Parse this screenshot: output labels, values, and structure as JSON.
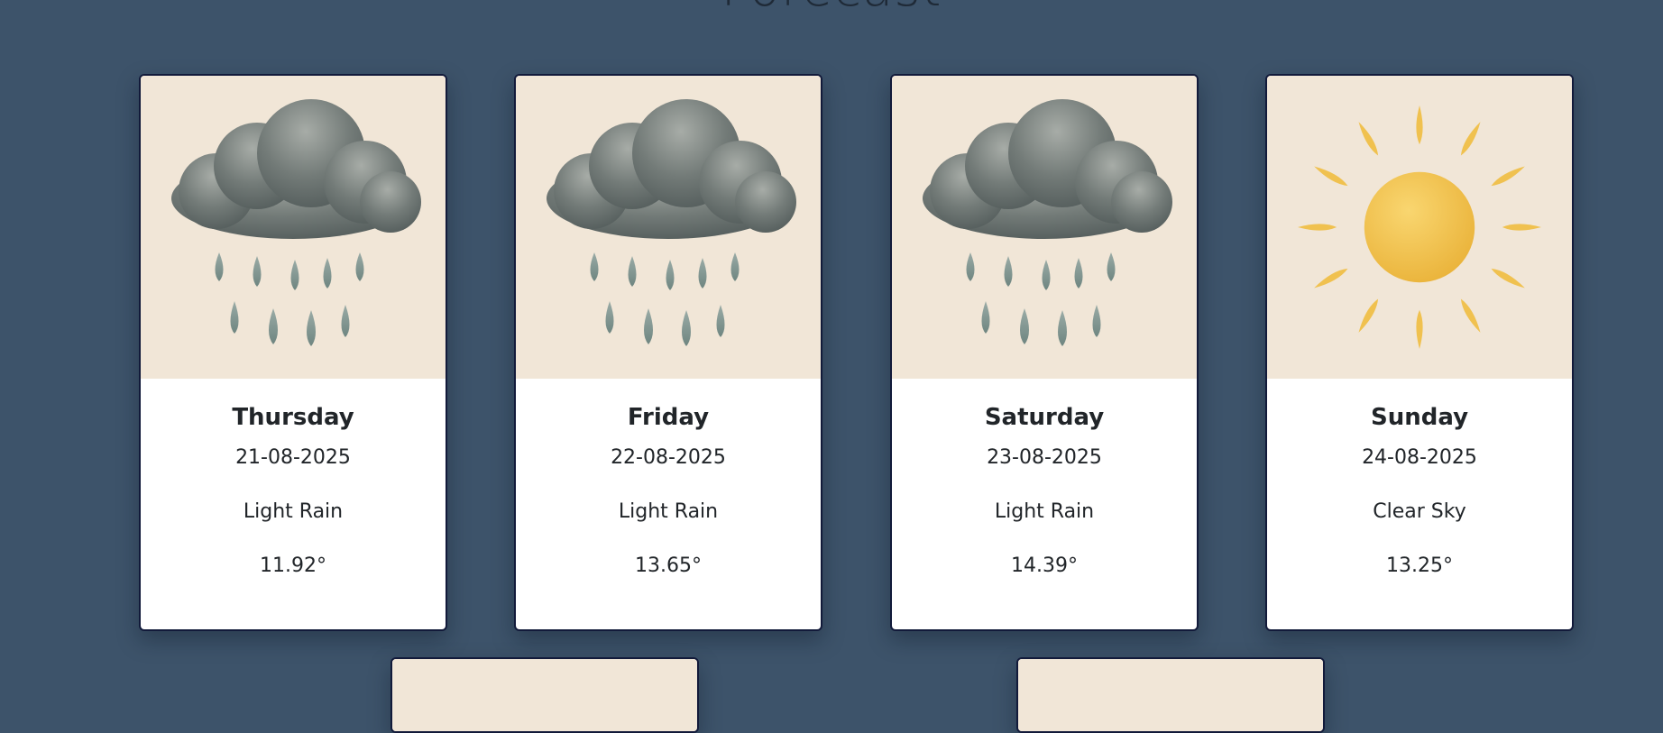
{
  "page": {
    "title": "Forecast"
  },
  "colors": {
    "background": "#3d536a",
    "card_border": "#121a3a",
    "image_background": "#f1e6d7",
    "cloud": "#6c7472",
    "rain": "#7f9690",
    "sun": "#f2c24a"
  },
  "forecast": [
    {
      "day": "Thursday",
      "date": "21-08-2025",
      "description": "Light Rain",
      "temperature": "11.92°",
      "icon": "rain-cloud-icon"
    },
    {
      "day": "Friday",
      "date": "22-08-2025",
      "description": "Light Rain",
      "temperature": "13.65°",
      "icon": "rain-cloud-icon"
    },
    {
      "day": "Saturday",
      "date": "23-08-2025",
      "description": "Light Rain",
      "temperature": "14.39°",
      "icon": "rain-cloud-icon"
    },
    {
      "day": "Sunday",
      "date": "24-08-2025",
      "description": "Clear Sky",
      "temperature": "13.25°",
      "icon": "sun-icon"
    }
  ]
}
